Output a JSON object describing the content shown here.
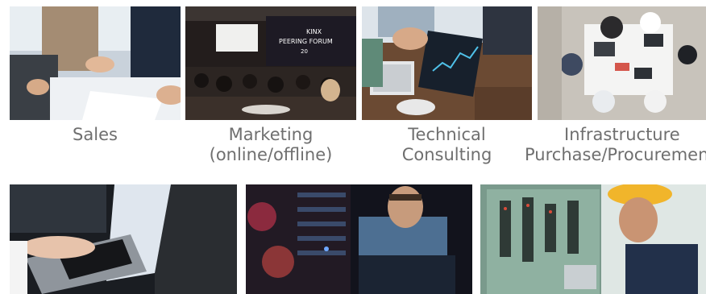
{
  "services": [
    {
      "id": "sales",
      "lines": [
        "Sales"
      ],
      "photo": "handshake-photo"
    },
    {
      "id": "marketing",
      "lines": [
        "Marketing",
        "(online/offline)"
      ],
      "photo": "conference-photo",
      "screen_text": [
        "KINX",
        "PEERING FORUM",
        "20"
      ]
    },
    {
      "id": "technical-consulting",
      "lines": [
        "Technical",
        "Consulting"
      ],
      "photo": "tablet-keyboard-photo"
    },
    {
      "id": "infrastructure",
      "lines": [
        "Infrastructure",
        "Purchase/Procurement"
      ],
      "photo": "meeting-overhead-photo"
    }
  ],
  "bottom_photos": [
    "laptop-typing-photo",
    "server-rack-engineer-photo",
    "control-panel-worker-photo"
  ],
  "colors": {
    "caption": "#6f6f6f",
    "background": "#ffffff"
  }
}
